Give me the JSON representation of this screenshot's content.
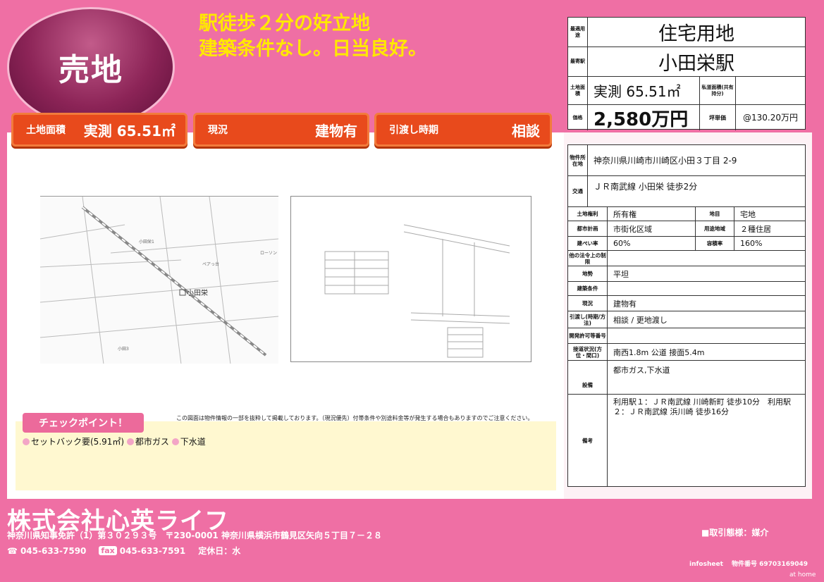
{
  "sale_badge": "売地",
  "catch_lines": [
    "駅徒歩２分の好立地",
    "建築条件なし。日当良好。"
  ],
  "badges": [
    {
      "label": "土地面積",
      "value": "実測 65.51㎡"
    },
    {
      "label": "現況",
      "value": "建物有"
    },
    {
      "label": "引渡し時期",
      "value": "相談"
    }
  ],
  "top_table": {
    "use_label": "最適用途",
    "use_value": "住宅用地",
    "station_label": "最寄駅",
    "station_value": "小田栄駅",
    "area_label": "土地面積",
    "area_value": "実測 65.51㎡",
    "private_road_label": "私道面積(共有持分)",
    "private_road_value": "",
    "price_label": "価格",
    "price_value": "2,580万円",
    "tsubo_label": "坪単価",
    "tsubo_value": "@130.20万円"
  },
  "notice": "この図面は物件情報の一部を抜粋して掲載しております。（現況優先）付帯条件や別途料金等が発生する場合もありますのでご注意ください。",
  "check_title": "チェックポイント！",
  "check_items": [
    "セットバック要(5.91㎡)",
    "都市ガス",
    "下水道"
  ],
  "map": {
    "station": "小田栄",
    "labels": [
      "小田栄1",
      "小田3",
      "ペアっ台",
      "ローソン"
    ]
  },
  "details": {
    "location_label": "物件所在地",
    "location": "神奈川県川崎市川崎区小田３丁目 2-9",
    "traffic_label": "交通",
    "traffic": "ＪＲ南武線 小田栄 徒歩2分",
    "rights_label": "土地権利",
    "rights": "所有権",
    "chimoku_label": "地目",
    "chimoku": "宅地",
    "city_plan_label": "都市計画",
    "city_plan": "市街化区域",
    "zone_label": "用途地域",
    "zone": "２種住居",
    "bcr_label": "建ぺい率",
    "bcr": "60%",
    "far_label": "容積率",
    "far": "160%",
    "other_law_label": "他の法令上の制限",
    "other_law": "",
    "terrain_label": "地勢",
    "terrain": "平坦",
    "build_cond_label": "建築条件",
    "build_cond": "",
    "status_label": "現況",
    "status": "建物有",
    "handover_label": "引渡し(時期/方法)",
    "handover": "相談 / 更地渡し",
    "permit_label": "開発許可等番号",
    "permit": "",
    "road_label": "接道状況(方位・間口)",
    "road": "南西1.8m 公道 接面5.4m",
    "facility_label": "設備",
    "facility": "都市ガス,下水道",
    "remarks_label": "備考",
    "remarks": "利用駅１：ＪＲ南武線 川崎新町 徒歩10分　利用駅２：ＪＲ南武線 浜川崎 徒歩16分"
  },
  "company": "株式会社心英ライフ",
  "address": "神奈川県知事免許（1）第３０２９３号　〒230-0001 神奈川県横浜市鶴見区矢向５丁目７－２８",
  "tel": "045-633-7590",
  "fax_label": "fax",
  "fax": "045-633-7591",
  "holiday": "定休日：水",
  "deal_type": "■取引態様：媒介",
  "infosheet": "infosheet　 物件番号  69703169049",
  "athome": "at home"
}
